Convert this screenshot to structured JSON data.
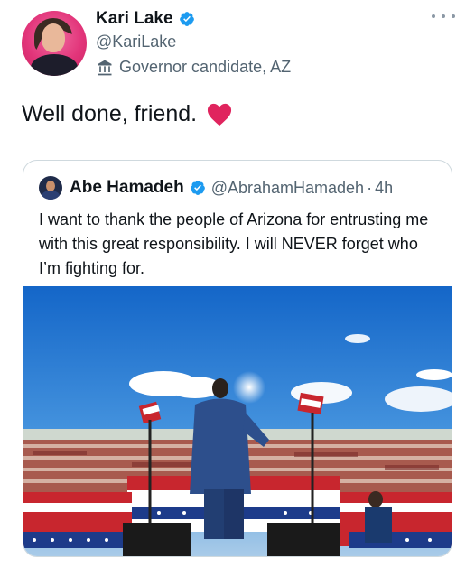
{
  "tweet": {
    "author_name": "Kari Lake",
    "author_handle": "@KariLake",
    "author_label": "Governor candidate, AZ",
    "text": "Well done, friend.",
    "emoji": "heart"
  },
  "quoted_tweet": {
    "author_name": "Abe Hamadeh",
    "author_handle": "@AbrahamHamadeh",
    "separator": "·",
    "time": "4h",
    "text": "I want to thank the people of Arizona for entrusting me with this great responsibility. I will NEVER forget who I’m fighting for."
  },
  "icons": {
    "verified": "verified-badge-icon",
    "label": "government-building-icon",
    "more": "more-options-icon"
  },
  "colors": {
    "verified_blue": "#1d9bf0",
    "heart_red": "#e0245e",
    "secondary_text": "#536471"
  }
}
